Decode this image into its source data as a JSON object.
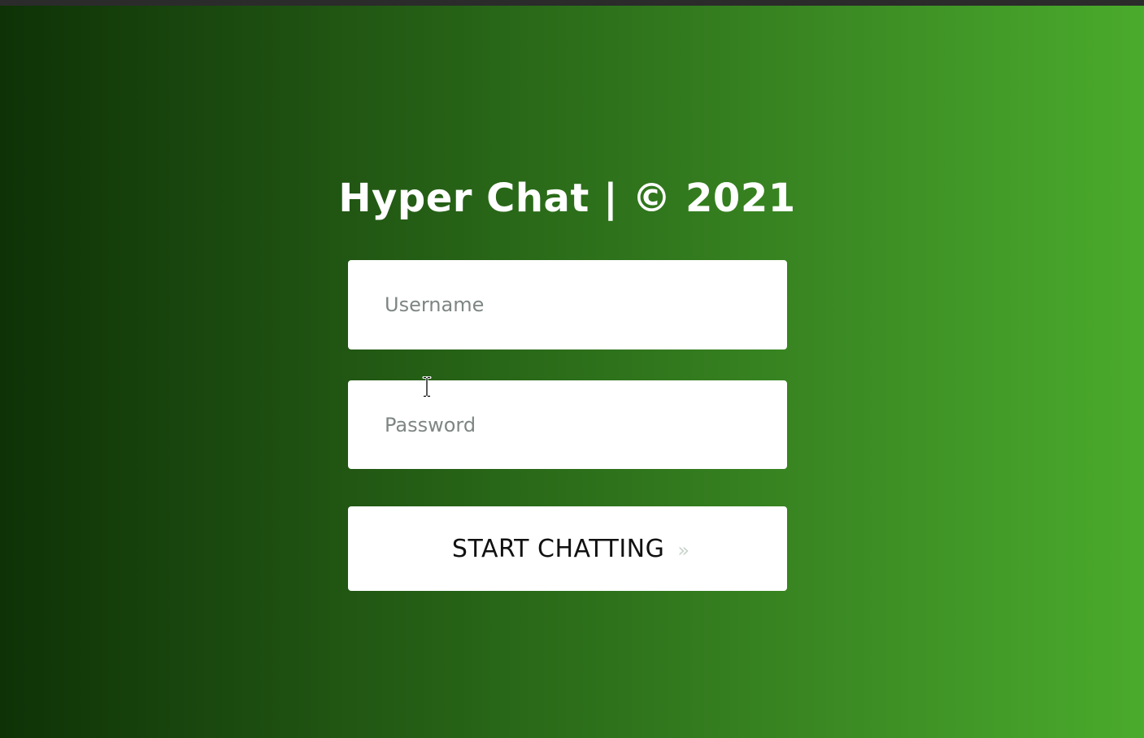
{
  "app": {
    "title": "Hyper Chat | © 2021"
  },
  "login_form": {
    "username_placeholder": "Username",
    "password_placeholder": "Password",
    "submit_label": "START CHATTING",
    "submit_icon": "»"
  },
  "icons": {
    "submit_icon_name": "double-chevron-right-icon",
    "cursor_icon_name": "text-cursor-icon"
  },
  "colors": {
    "gradient_start": "#0e3206",
    "gradient_end": "#4aab2c",
    "field_background": "#ffffff",
    "placeholder_text": "#7e8684"
  }
}
